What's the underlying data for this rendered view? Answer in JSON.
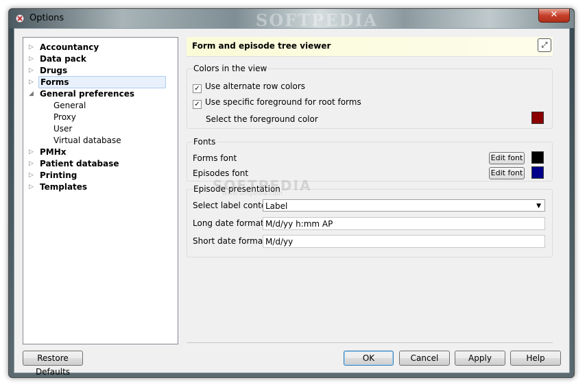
{
  "window": {
    "title": "Options",
    "title_watermark": "SOFTPEDIA"
  },
  "icons": {
    "app": "options-app-icon",
    "close": "close-icon",
    "expand": "expand-icon",
    "checkbox": "check-icon"
  },
  "tree": {
    "items": [
      {
        "label": "Accountancy",
        "level": 0,
        "bold": true,
        "arrow": "▷"
      },
      {
        "label": "Data pack",
        "level": 0,
        "bold": true,
        "arrow": "▷"
      },
      {
        "label": "Drugs",
        "level": 0,
        "bold": true,
        "arrow": "▷"
      },
      {
        "label": "Forms",
        "level": 0,
        "bold": true,
        "arrow": "▷",
        "selected": true
      },
      {
        "label": "General preferences",
        "level": 0,
        "bold": true,
        "arrow": "◢"
      },
      {
        "label": "General",
        "level": 1,
        "bold": false,
        "arrow": ""
      },
      {
        "label": "Proxy",
        "level": 1,
        "bold": false,
        "arrow": ""
      },
      {
        "label": "User",
        "level": 1,
        "bold": false,
        "arrow": ""
      },
      {
        "label": "Virtual database",
        "level": 1,
        "bold": false,
        "arrow": ""
      },
      {
        "label": "PMHx",
        "level": 0,
        "bold": true,
        "arrow": "▷"
      },
      {
        "label": "Patient database",
        "level": 0,
        "bold": true,
        "arrow": "▷"
      },
      {
        "label": "Printing",
        "level": 0,
        "bold": true,
        "arrow": "▷"
      },
      {
        "label": "Templates",
        "level": 0,
        "bold": true,
        "arrow": "▷"
      }
    ]
  },
  "panel": {
    "title": "Form and episode tree viewer",
    "colors_group": {
      "title": "Colors in the view",
      "alt_rows": {
        "label": "Use alternate row colors",
        "checked": true
      },
      "root_fg": {
        "label": "Use specific foreground for root forms",
        "checked": true
      },
      "fg_select_label": "Select the foreground color",
      "fg_color": "#8b0000"
    },
    "fonts_group": {
      "title": "Fonts",
      "forms_font_label": "Forms font",
      "episodes_font_label": "Episodes font",
      "edit_font_label": "Edit font",
      "forms_font_color": "#000000",
      "episodes_font_color": "#00008b"
    },
    "episode_group": {
      "title": "Episode presentation",
      "label_content_label": "Select label content",
      "label_content_value": "Label",
      "long_date_label": "Long date format",
      "long_date_value": "M/d/yy h:mm AP",
      "short_date_label": "Short date format",
      "short_date_value": "M/d/yy"
    },
    "watermark": "SOFTPEDIA",
    "watermark_url": "www.softpedia.com"
  },
  "buttons": {
    "restore": "Restore Defaults",
    "ok": "OK",
    "cancel": "Cancel",
    "apply": "Apply",
    "help": "Help"
  }
}
